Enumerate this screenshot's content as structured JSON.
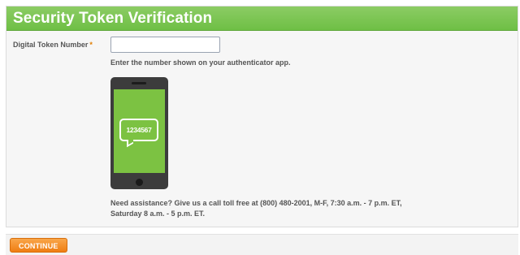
{
  "header": {
    "title": "Security Token Verification"
  },
  "form": {
    "token_label": "Digital Token Number",
    "required_marker": "*",
    "token_value": "",
    "hint": "Enter the number shown on your authenticator app."
  },
  "phone_illustration": {
    "code": "1234567"
  },
  "assistance": {
    "line1": "Need assistance? Give us a call toll free at (800) 480-2001, M-F, 7:30 a.m. - 7 p.m. ET,",
    "line2": "Saturday 8 a.m. - 5 p.m. ET."
  },
  "footer": {
    "continue_label": "CONTINUE"
  },
  "colors": {
    "header_green": "#6fbf45",
    "screen_green": "#7cc242",
    "button_orange": "#ef7d12",
    "required_orange": "#e07d00"
  }
}
